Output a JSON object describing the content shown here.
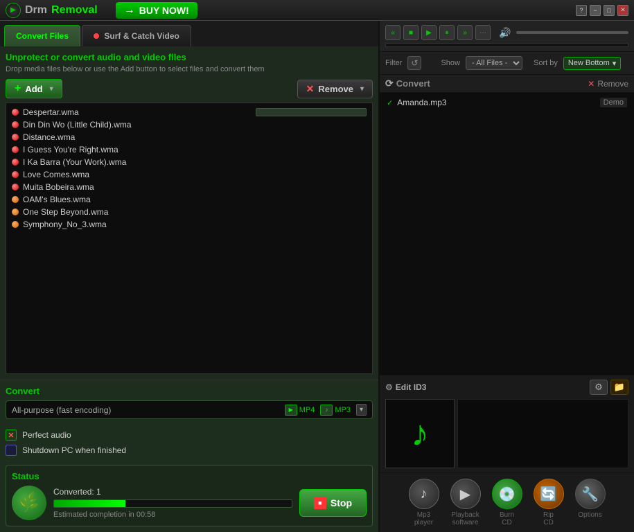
{
  "titlebar": {
    "app_name_drm": "Drm",
    "app_name_removal": "Removal",
    "buy_now": "BUY NOW!",
    "help": "?",
    "minimize": "−",
    "maximize": "□",
    "close": "✕"
  },
  "tabs": {
    "tab1": "Convert Files",
    "tab2": "Surf & Catch Video",
    "tab2_active": false
  },
  "file_area": {
    "header": "Unprotect or convert audio and video files",
    "subheader": "Drop media files below or use the Add button to select files and convert them",
    "add_label": "Add",
    "remove_label": "Remove",
    "files": [
      {
        "name": "Despertar.wma",
        "dot": "red"
      },
      {
        "name": "Din Din Wo (Little Child).wma",
        "dot": "red"
      },
      {
        "name": "Distance.wma",
        "dot": "red"
      },
      {
        "name": "I Guess You're Right.wma",
        "dot": "red"
      },
      {
        "name": "I Ka Barra (Your Work).wma",
        "dot": "red"
      },
      {
        "name": "Love Comes.wma",
        "dot": "red"
      },
      {
        "name": "Muita Bobeira.wma",
        "dot": "red"
      },
      {
        "name": "OAM's Blues.wma",
        "dot": "orange"
      },
      {
        "name": "One Step Beyond.wma",
        "dot": "orange"
      },
      {
        "name": "Symphony_No_3.wma",
        "dot": "orange"
      }
    ]
  },
  "convert": {
    "label": "Convert",
    "profile": "All-purpose (fast encoding)",
    "format1": "MP4",
    "format2": "MP3",
    "perfect_audio_label": "Perfect audio",
    "shutdown_label": "Shutdown PC when finished"
  },
  "status": {
    "label": "Status",
    "converted_text": "Converted: 1",
    "eta_text": "Estimated completion in 00:58",
    "progress_percent": 30,
    "stop_label": "Stop"
  },
  "right_panel": {
    "transport": {
      "rewind": "«",
      "stop": "■",
      "play": "▶",
      "pause": "⏸",
      "fast_forward": "»",
      "more": "···"
    },
    "filter": {
      "label": "Filter",
      "show_label": "Show",
      "sort_label": "Sort by",
      "filter_value": "- All Files -",
      "sort_value": "New Bottom"
    },
    "convert_btn": "Convert",
    "remove_btn": "Remove",
    "files": [
      {
        "name": "Amanda.mp3",
        "tag": "Demo",
        "checked": true
      }
    ],
    "edit_id3_label": "Edit ID3",
    "bottom_icons": [
      {
        "label": "Mp3\nplayer",
        "icon": "♪",
        "style": "bi-gray"
      },
      {
        "label": "Playback\nsoftware",
        "icon": "▶",
        "style": "bi-gray"
      },
      {
        "label": "Burn\nCD",
        "icon": "💿",
        "style": "bi-green"
      },
      {
        "label": "Rip\nCD",
        "icon": "🔄",
        "style": "bi-orange"
      },
      {
        "label": "Options",
        "icon": "🔧",
        "style": "bi-tools"
      }
    ]
  }
}
